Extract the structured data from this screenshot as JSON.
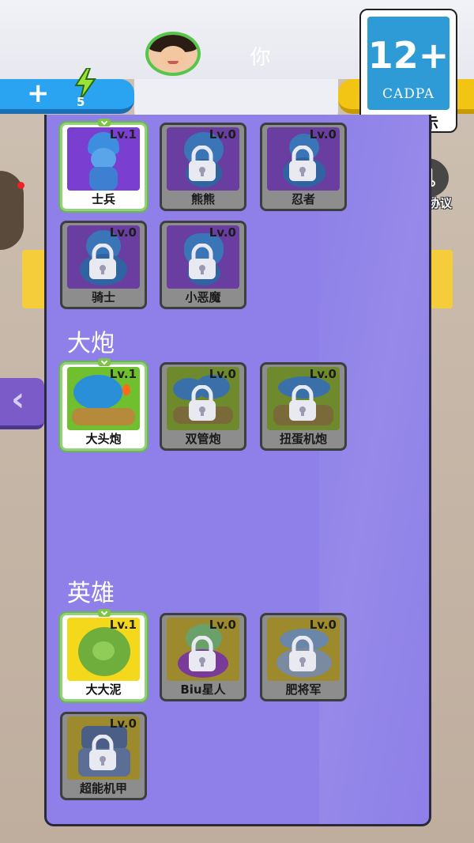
{
  "header": {
    "username": "你",
    "energy_plus": "+",
    "energy_count": "5"
  },
  "rating": {
    "age": "12+",
    "org": "CADPA",
    "label": "适龄提示"
  },
  "side": {
    "privacy_label": "隐私协议",
    "left_arrow": "‹"
  },
  "sections": {
    "soldiers": {
      "cards": [
        {
          "name": "士兵",
          "level": "Lv.1",
          "locked": false
        },
        {
          "name": "熊熊",
          "level": "Lv.0",
          "locked": true
        },
        {
          "name": "忍者",
          "level": "Lv.0",
          "locked": true
        },
        {
          "name": "骑士",
          "level": "Lv.0",
          "locked": true
        },
        {
          "name": "小恶魔",
          "level": "Lv.0",
          "locked": true
        }
      ]
    },
    "cannons": {
      "title": "大炮",
      "cards": [
        {
          "name": "大头炮",
          "level": "Lv.1",
          "locked": false
        },
        {
          "name": "双管炮",
          "level": "Lv.0",
          "locked": true
        },
        {
          "name": "扭蛋机炮",
          "level": "Lv.0",
          "locked": true
        }
      ]
    },
    "heroes": {
      "title": "英雄",
      "cards": [
        {
          "name": "大大泥",
          "level": "Lv.1",
          "locked": false
        },
        {
          "name": "Biu星人",
          "level": "Lv.0",
          "locked": true
        },
        {
          "name": "肥将军",
          "level": "Lv.0",
          "locked": true
        },
        {
          "name": "超能机甲",
          "level": "Lv.0",
          "locked": true
        }
      ]
    }
  },
  "colors": {
    "panel": "#8e80e8",
    "energy_blue": "#2aa3f0",
    "gold": "#f2c414",
    "unlocked_border": "#95d07a"
  }
}
